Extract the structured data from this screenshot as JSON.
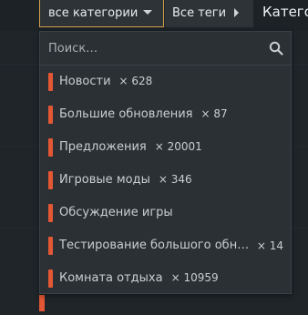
{
  "filters": {
    "categories_button": "все категории",
    "tags_button": "Все теги",
    "nav_tab": "Категории"
  },
  "dropdown": {
    "search_placeholder": "Поиск…",
    "items": [
      {
        "label": "Новости",
        "count": "× 628",
        "color": "#e45735"
      },
      {
        "label": "Большие обновления",
        "count": "× 87",
        "color": "#e45735"
      },
      {
        "label": "Предложения",
        "count": "× 20001",
        "color": "#e45735"
      },
      {
        "label": "Игровые моды",
        "count": "× 346",
        "color": "#e45735"
      },
      {
        "label": "Обсуждение игры",
        "count": "",
        "color": "#e45735"
      },
      {
        "label": "Тестирование большого обн…",
        "count": "× 14",
        "color": "#e45735"
      },
      {
        "label": "Комната отдыха",
        "count": "× 10959",
        "color": "#e45735"
      }
    ]
  },
  "colors": {
    "accent": "#e45735",
    "active_border": "#d4a24e",
    "background": "#1c2226",
    "panel": "#2a3034"
  },
  "icons": {
    "search": "search-icon",
    "caret": "caret-down-icon",
    "tags_arrow": "caret-right-icon"
  }
}
